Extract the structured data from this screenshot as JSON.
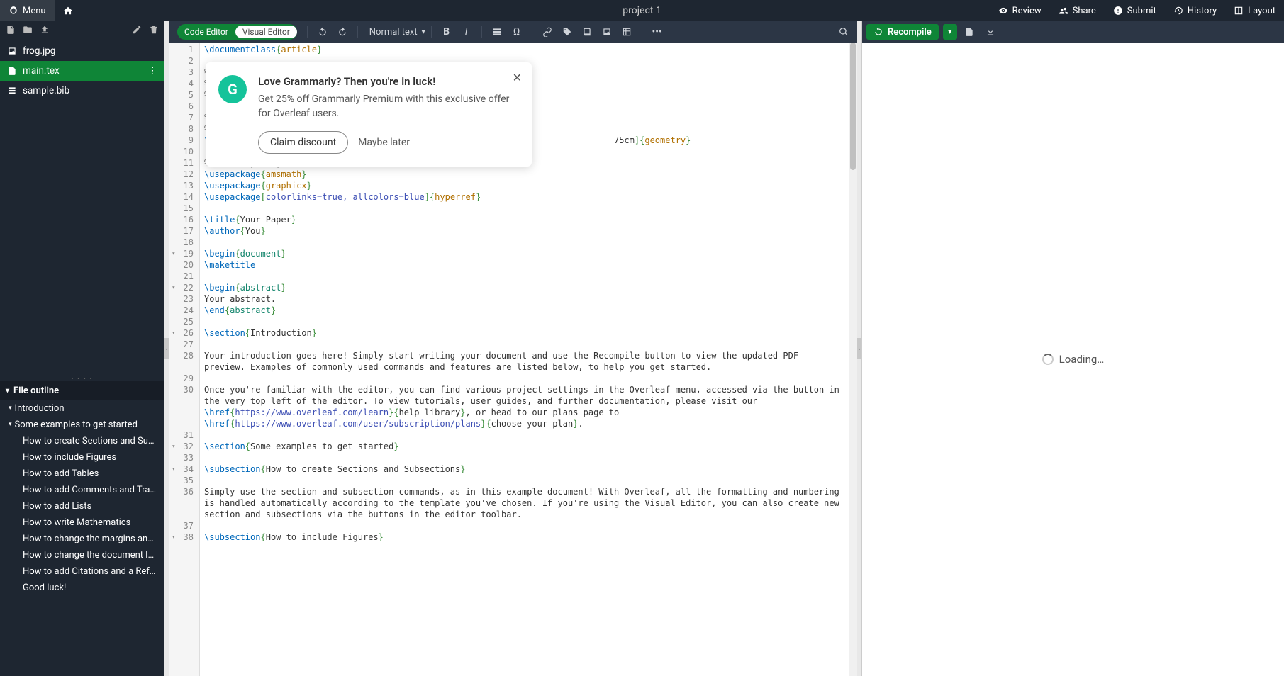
{
  "topbar": {
    "menu": "Menu",
    "title": "project 1",
    "review": "Review",
    "share": "Share",
    "submit": "Submit",
    "history": "History",
    "layout": "Layout"
  },
  "files": [
    {
      "name": "frog.jpg",
      "type": "image",
      "selected": false
    },
    {
      "name": "main.tex",
      "type": "tex",
      "selected": true
    },
    {
      "name": "sample.bib",
      "type": "bib",
      "selected": false
    }
  ],
  "outline": {
    "header": "File outline",
    "items": [
      {
        "label": "Introduction",
        "sub": []
      },
      {
        "label": "Some examples to get started",
        "sub": [
          "How to create Sections and Subsec...",
          "How to include Figures",
          "How to add Tables",
          "How to add Comments and Track ...",
          "How to add Lists",
          "How to write Mathematics",
          "How to change the margins and pa...",
          "How to change the document lang...",
          "How to add Citations and a Refere...",
          "Good luck!"
        ]
      }
    ]
  },
  "editor_toolbar": {
    "mode_code": "Code Editor",
    "mode_visual": "Visual Editor",
    "style_select": "Normal text"
  },
  "code": {
    "lines": [
      {
        "n": 1,
        "tokens": [
          [
            "cmd",
            "\\documentclass"
          ],
          [
            "brace",
            "{"
          ],
          [
            "arg",
            "article"
          ],
          [
            "brace",
            "}"
          ]
        ]
      },
      {
        "n": 2,
        "tokens": []
      },
      {
        "n": 3,
        "tokens": [
          [
            "comment",
            "% "
          ]
        ]
      },
      {
        "n": 4,
        "tokens": [
          [
            "comment",
            "% "
          ]
        ]
      },
      {
        "n": 5,
        "tokens": [
          [
            "comment",
            "% "
          ]
        ]
      },
      {
        "n": 6,
        "tokens": []
      },
      {
        "n": 7,
        "tokens": [
          [
            "comment",
            "% "
          ]
        ]
      },
      {
        "n": 8,
        "tokens": [
          [
            "comment",
            "% "
          ]
        ]
      },
      {
        "n": 9,
        "tokens": [
          [
            "cmd",
            "\\"
          ],
          [
            "text",
            "                                                                               75cm"
          ],
          [
            "brace",
            "]{"
          ],
          [
            "arg",
            "geometry"
          ],
          [
            "brace",
            "}"
          ]
        ]
      },
      {
        "n": 10,
        "tokens": []
      },
      {
        "n": 11,
        "tokens": [
          [
            "comment",
            "% Useful packages"
          ]
        ]
      },
      {
        "n": 12,
        "tokens": [
          [
            "cmd",
            "\\usepackage"
          ],
          [
            "brace",
            "{"
          ],
          [
            "arg",
            "amsmath"
          ],
          [
            "brace",
            "}"
          ]
        ]
      },
      {
        "n": 13,
        "tokens": [
          [
            "cmd",
            "\\usepackage"
          ],
          [
            "brace",
            "{"
          ],
          [
            "arg",
            "graphicx"
          ],
          [
            "brace",
            "}"
          ]
        ]
      },
      {
        "n": 14,
        "tokens": [
          [
            "cmd",
            "\\usepackage"
          ],
          [
            "brace",
            "["
          ],
          [
            "opt",
            "colorlinks=true, allcolors=blue"
          ],
          [
            "brace",
            "]{"
          ],
          [
            "arg",
            "hyperref"
          ],
          [
            "brace",
            "}"
          ]
        ]
      },
      {
        "n": 15,
        "tokens": []
      },
      {
        "n": 16,
        "tokens": [
          [
            "cmd",
            "\\title"
          ],
          [
            "brace",
            "{"
          ],
          [
            "text",
            "Your Paper"
          ],
          [
            "brace",
            "}"
          ]
        ]
      },
      {
        "n": 17,
        "tokens": [
          [
            "cmd",
            "\\author"
          ],
          [
            "brace",
            "{"
          ],
          [
            "text",
            "You"
          ],
          [
            "brace",
            "}"
          ]
        ]
      },
      {
        "n": 18,
        "tokens": []
      },
      {
        "n": 19,
        "fold": true,
        "tokens": [
          [
            "cmd",
            "\\begin"
          ],
          [
            "brace",
            "{"
          ],
          [
            "keyword2",
            "document"
          ],
          [
            "brace",
            "}"
          ]
        ]
      },
      {
        "n": 20,
        "tokens": [
          [
            "cmd",
            "\\maketitle"
          ]
        ]
      },
      {
        "n": 21,
        "tokens": []
      },
      {
        "n": 22,
        "fold": true,
        "tokens": [
          [
            "cmd",
            "\\begin"
          ],
          [
            "brace",
            "{"
          ],
          [
            "keyword2",
            "abstract"
          ],
          [
            "brace",
            "}"
          ]
        ]
      },
      {
        "n": 23,
        "tokens": [
          [
            "text",
            "Your abstract."
          ]
        ]
      },
      {
        "n": 24,
        "tokens": [
          [
            "cmd",
            "\\end"
          ],
          [
            "brace",
            "{"
          ],
          [
            "keyword2",
            "abstract"
          ],
          [
            "brace",
            "}"
          ]
        ]
      },
      {
        "n": 25,
        "tokens": []
      },
      {
        "n": 26,
        "fold": true,
        "tokens": [
          [
            "cmd",
            "\\section"
          ],
          [
            "brace",
            "{"
          ],
          [
            "text",
            "Introduction"
          ],
          [
            "brace",
            "}"
          ]
        ]
      },
      {
        "n": 27,
        "tokens": []
      },
      {
        "n": 28,
        "tokens": [
          [
            "text",
            "Your introduction goes here! Simply start writing your document and use the Recompile button to view the updated PDF preview. Examples of commonly used commands and features are listed below, to help you get started."
          ]
        ]
      },
      {
        "n": 29,
        "tokens": []
      },
      {
        "n": 30,
        "tokens": [
          [
            "text",
            "Once you're familiar with the editor, you can find various project settings in the Overleaf menu, accessed via the button in the very top left of the editor. To view tutorials, user guides, and further documentation, please visit our "
          ],
          [
            "cmd",
            "\\href"
          ],
          [
            "brace",
            "{"
          ],
          [
            "url",
            "https://www.overleaf.com/learn"
          ],
          [
            "brace",
            "}{"
          ],
          [
            "text",
            "help library"
          ],
          [
            "brace",
            "}"
          ],
          [
            "text",
            ", or head to our plans page to "
          ],
          [
            "cmd",
            "\\href"
          ],
          [
            "brace",
            "{"
          ],
          [
            "url",
            "https://www.overleaf.com/user/subscription/plans"
          ],
          [
            "brace",
            "}{"
          ],
          [
            "text",
            "choose your plan"
          ],
          [
            "brace",
            "}"
          ],
          [
            "text",
            "."
          ]
        ]
      },
      {
        "n": 31,
        "tokens": []
      },
      {
        "n": 32,
        "fold": true,
        "tokens": [
          [
            "cmd",
            "\\section"
          ],
          [
            "brace",
            "{"
          ],
          [
            "text",
            "Some examples to get started"
          ],
          [
            "brace",
            "}"
          ]
        ]
      },
      {
        "n": 33,
        "tokens": []
      },
      {
        "n": 34,
        "fold": true,
        "tokens": [
          [
            "cmd",
            "\\subsection"
          ],
          [
            "brace",
            "{"
          ],
          [
            "text",
            "How to create Sections and Subsections"
          ],
          [
            "brace",
            "}"
          ]
        ]
      },
      {
        "n": 35,
        "tokens": []
      },
      {
        "n": 36,
        "tokens": [
          [
            "text",
            "Simply use the section and subsection commands, as in this example document! With Overleaf, all the formatting and numbering is handled automatically according to the template you've chosen. If you're using the Visual Editor, you can also create new section and subsections via the buttons in the editor toolbar."
          ]
        ]
      },
      {
        "n": 37,
        "tokens": []
      },
      {
        "n": 38,
        "fold": true,
        "tokens": [
          [
            "cmd",
            "\\subsection"
          ],
          [
            "brace",
            "{"
          ],
          [
            "text",
            "How to include Figures"
          ],
          [
            "brace",
            "}"
          ]
        ]
      }
    ]
  },
  "right": {
    "recompile": "Recompile",
    "loading": "Loading…"
  },
  "popup": {
    "title": "Love Grammarly? Then you're in luck!",
    "body": "Get 25% off Grammarly Premium with this exclusive offer for Overleaf users.",
    "claim": "Claim discount",
    "later": "Maybe later",
    "logo_text": "G"
  }
}
